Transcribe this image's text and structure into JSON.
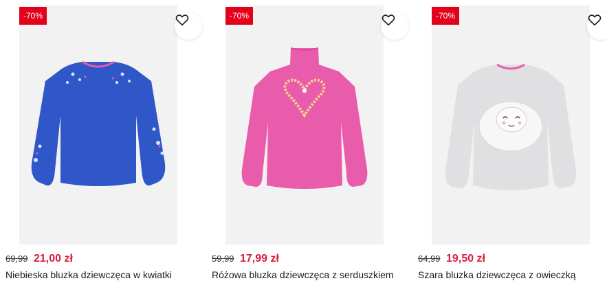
{
  "products": [
    {
      "badge": "-70%",
      "old_price": "69,99",
      "new_price": "21,00 zł",
      "name": "Niebieska bluzka dziewczęca w kwiatki",
      "image_icon": "blue-floral-top",
      "shirt_color": "#2f57c8"
    },
    {
      "badge": "-70%",
      "old_price": "59,99",
      "new_price": "17,99 zł",
      "name": "Różowa bluzka dziewczęca z serduszkiem",
      "image_icon": "pink-heart-turtleneck",
      "shirt_color": "#e95bab"
    },
    {
      "badge": "-70%",
      "old_price": "64,99",
      "new_price": "19,50 zł",
      "name": "Szara bluzka dziewczęca z owieczką",
      "image_icon": "grey-sheep-top",
      "shirt_color": "#e0e0e2"
    }
  ],
  "colors": {
    "sale": "#e2001a",
    "price": "#d91c3a"
  }
}
